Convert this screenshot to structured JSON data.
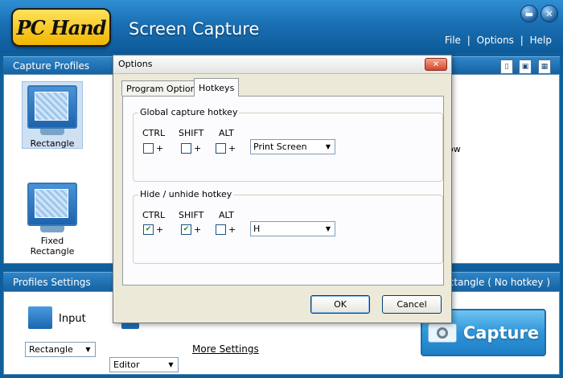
{
  "app": {
    "logo_text": "PC Hand",
    "title": "Screen Capture",
    "menu": [
      "File",
      "Options",
      "Help"
    ],
    "menu_sep": "|",
    "min_glyph": "▬",
    "close_glyph": "✕"
  },
  "capture_profiles": {
    "title": "Capture Profiles",
    "items": [
      {
        "label": "Rectangle",
        "selected": true
      },
      {
        "label": "Fixed Rectangle",
        "selected": false
      }
    ],
    "partial_right_label": "ow"
  },
  "profiles_settings": {
    "title": "Profiles Settings",
    "status": "Rectangle ( No hotkey )",
    "input_label": "Input",
    "input_select": "Rectangle",
    "output_select": "Editor",
    "more_settings": "More Settings",
    "capture_label": "Capture"
  },
  "dialog": {
    "title": "Options",
    "close_glyph": "✕",
    "tabs": [
      "Program Options",
      "Hotkeys"
    ],
    "active_tab": "Hotkeys",
    "groups": [
      {
        "title": "Global capture hotkey",
        "mods": [
          "CTRL",
          "SHIFT",
          "ALT"
        ],
        "checked": [
          false,
          false,
          false
        ],
        "key": "Print Screen"
      },
      {
        "title": "Hide / unhide hotkey",
        "mods": [
          "CTRL",
          "SHIFT",
          "ALT"
        ],
        "checked": [
          true,
          true,
          false
        ],
        "key": "H"
      }
    ],
    "plus": "+",
    "ok_label": "OK",
    "cancel_label": "Cancel"
  },
  "colors": {
    "header": "#1a6fb3",
    "accent": "#2f95d8"
  }
}
